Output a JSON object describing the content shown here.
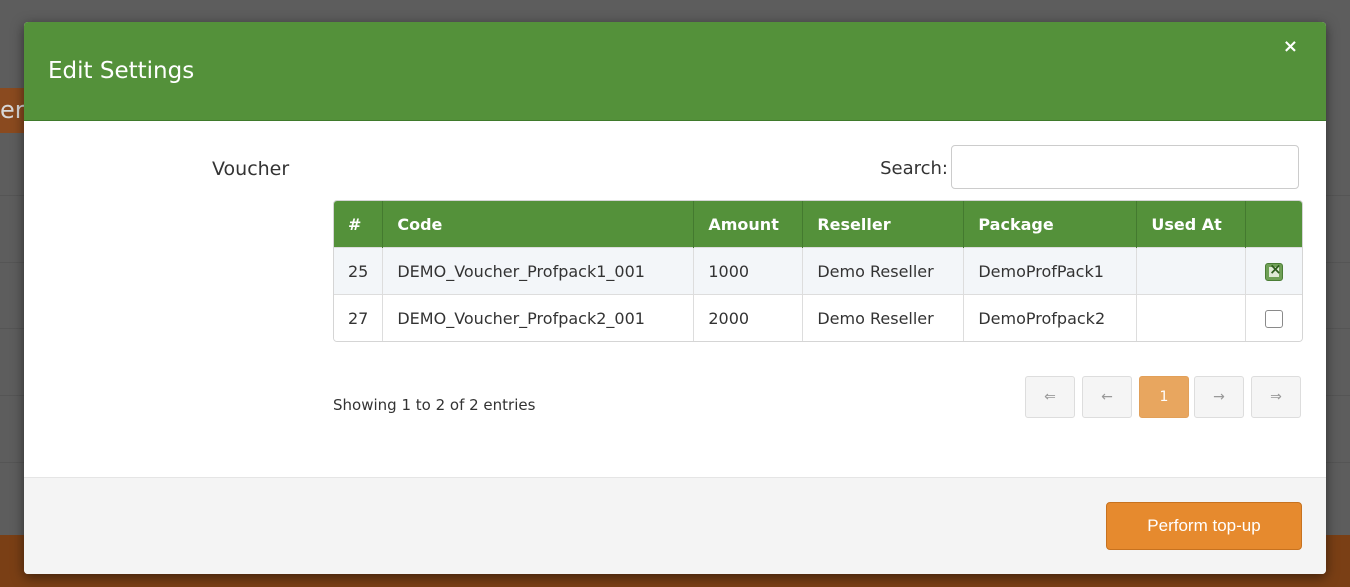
{
  "modal": {
    "title": "Edit Settings",
    "close": "×"
  },
  "background": {
    "partial_text": "er"
  },
  "form": {
    "field_label": "Voucher",
    "search_label": "Search:",
    "search_value": ""
  },
  "table": {
    "columns": [
      "#",
      "Code",
      "Amount",
      "Reseller",
      "Package",
      "Used At",
      ""
    ],
    "rows": [
      {
        "id": "25",
        "code": "DEMO_Voucher_Profpack1_001",
        "amount": "1000",
        "reseller": "Demo Reseller",
        "package": "DemoProfPack1",
        "used_at": "",
        "selected": true
      },
      {
        "id": "27",
        "code": "DEMO_Voucher_Profpack2_001",
        "amount": "2000",
        "reseller": "Demo Reseller",
        "package": "DemoProfpack2",
        "used_at": "",
        "selected": false
      }
    ]
  },
  "pagination": {
    "info": "Showing 1 to 2 of 2 entries",
    "first": "⇐",
    "prev": "←",
    "current": "1",
    "next": "→",
    "last": "⇒"
  },
  "footer": {
    "perform_label": "Perform top-up"
  },
  "colors": {
    "header_green": "#54913a",
    "button_orange": "#e68a2e",
    "active_page": "#e8a65f"
  }
}
